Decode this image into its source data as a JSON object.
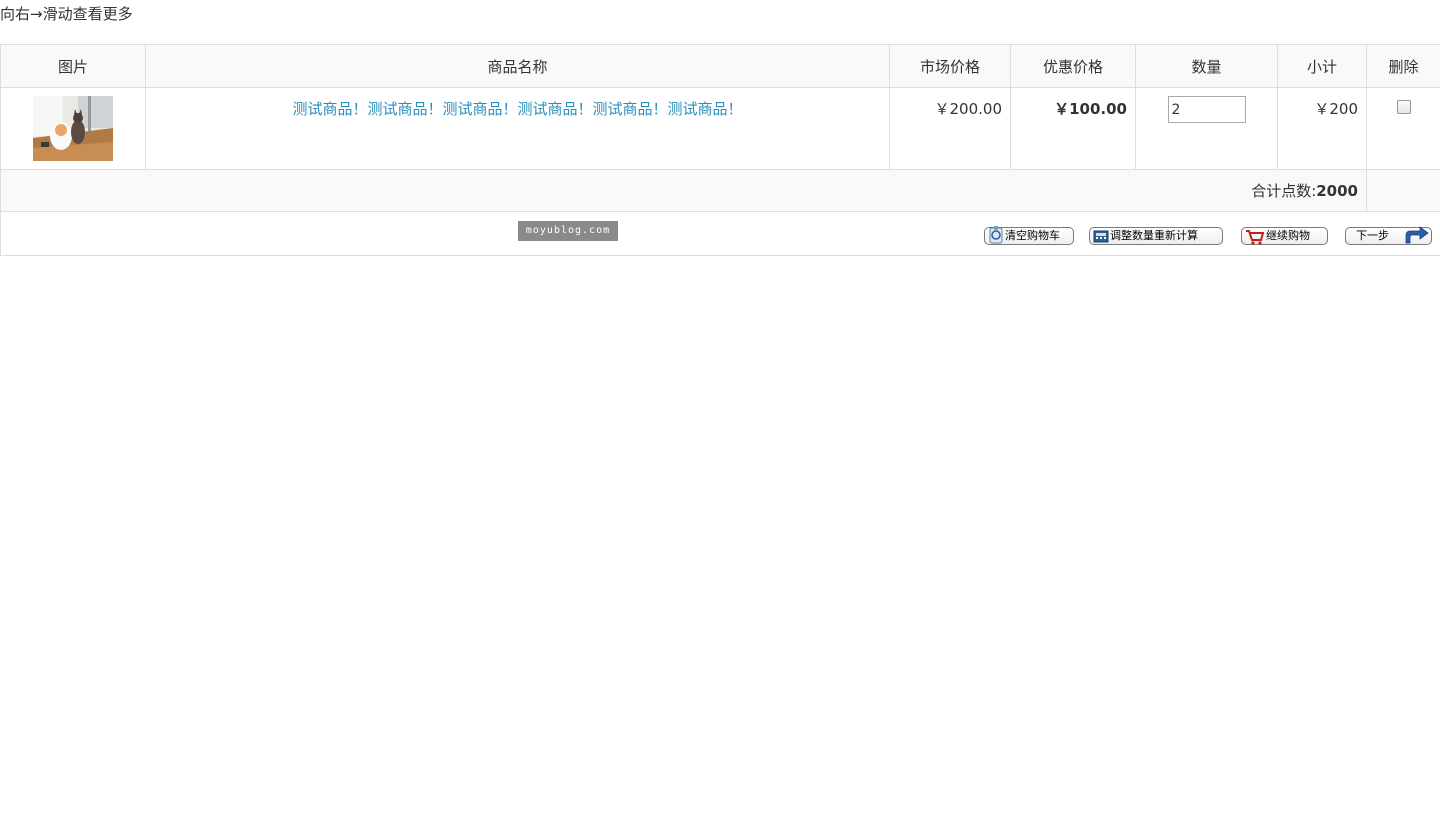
{
  "hint": "向右→滑动查看更多",
  "table": {
    "headers": {
      "image": "图片",
      "name": "商品名称",
      "market_price": "市场价格",
      "discount_price": "优惠价格",
      "quantity": "数量",
      "subtotal": "小计",
      "delete": "删除"
    },
    "items": [
      {
        "name": "测试商品！测试商品！测试商品！测试商品！测试商品！测试商品！",
        "market_price": "￥200.00",
        "discount_price": "￥100.00",
        "quantity": "2",
        "subtotal": "￥200"
      }
    ],
    "total": {
      "label": "合计点数:",
      "value": "2000"
    }
  },
  "watermark": "moyublog.com",
  "actions": {
    "clear_cart": "清空购物车",
    "recalculate": "调整数量重新计算",
    "continue_shopping": "继续购物",
    "next_step": "下一步"
  },
  "icons": {
    "clear": "cart-clear-icon",
    "recalc": "calculator-icon",
    "continue": "shopping-cart-icon",
    "next": "arrow-right-icon"
  },
  "colors": {
    "link": "#2a8fbd",
    "header_bg": "#f9f9f9",
    "border": "#dddddd"
  }
}
